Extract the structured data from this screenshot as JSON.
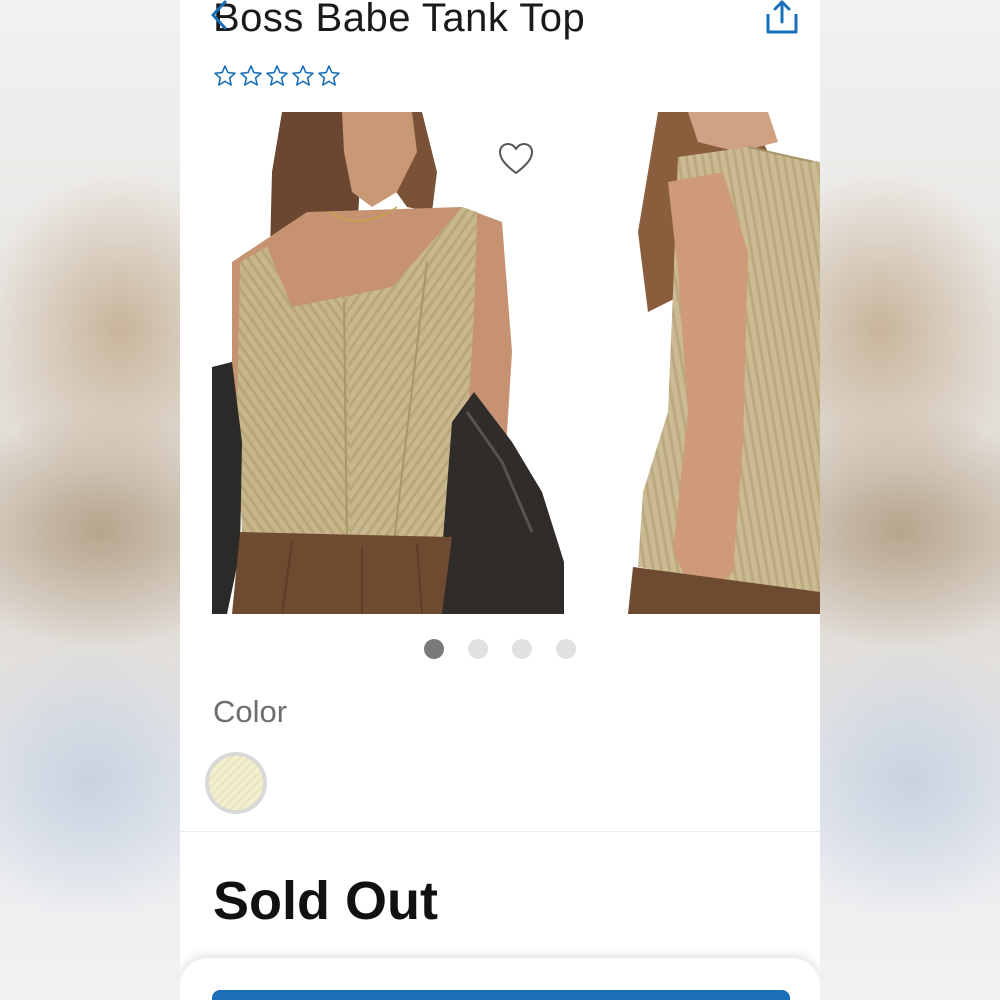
{
  "product": {
    "title": "Boss Babe Tank Top",
    "rating_stars": 5,
    "rating_filled": 0
  },
  "carousel": {
    "image_count": 4,
    "active_index": 0
  },
  "color_section": {
    "label": "Color",
    "selected_swatch": "light yellow ribbed"
  },
  "status": {
    "text": "Sold Out"
  },
  "icons": {
    "back": "chevron-left-icon",
    "share": "share-icon",
    "favorite": "heart-outline-icon",
    "star": "star-outline-icon"
  },
  "colors": {
    "accent": "#1a6fb8",
    "text": "#1a1a1a",
    "muted": "#6e6e6e",
    "fabric": "#c9b88c",
    "dot_active": "#7a7a7a",
    "dot_inactive": "#e1e1e1"
  }
}
